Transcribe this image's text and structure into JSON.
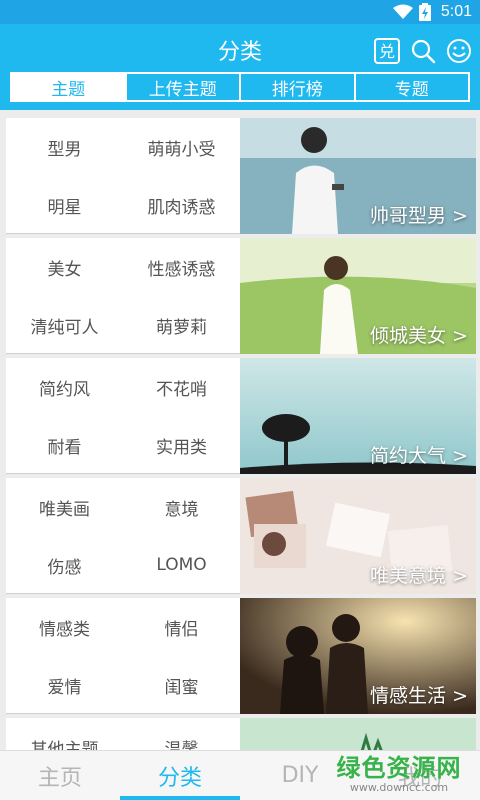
{
  "status_bar": {
    "time": "5:01"
  },
  "header": {
    "title": "分类",
    "icon_exchange": "兑",
    "tabs": [
      "主题",
      "上传主题",
      "排行榜",
      "专题"
    ]
  },
  "categories": [
    {
      "tags": [
        "型男",
        "萌萌小受",
        "明星",
        "肌肉诱惑"
      ],
      "banner": "帅哥型男 >"
    },
    {
      "tags": [
        "美女",
        "性感诱惑",
        "清纯可人",
        "萌萝莉"
      ],
      "banner": "倾城美女 >"
    },
    {
      "tags": [
        "简约风",
        "不花哨",
        "耐看",
        "实用类"
      ],
      "banner": "简约大气 >"
    },
    {
      "tags": [
        "唯美画",
        "意境",
        "伤感",
        "LOMO"
      ],
      "banner": "唯美意境 >"
    },
    {
      "tags": [
        "情感类",
        "情侣",
        "爱情",
        "闺蜜"
      ],
      "banner": "情感生活 >"
    },
    {
      "tags": [
        "其他主题",
        "温馨"
      ],
      "banner": ""
    }
  ],
  "bottom_nav": [
    "主页",
    "分类",
    "DIY",
    "我的"
  ],
  "watermark": {
    "title": "绿色资源网",
    "url": "www.downcc.com"
  },
  "colors": {
    "primary": "#1fb9f0",
    "statusbar": "#1fa5e6",
    "tag_text": "#555555",
    "nav_inactive": "#b5b5b5"
  }
}
